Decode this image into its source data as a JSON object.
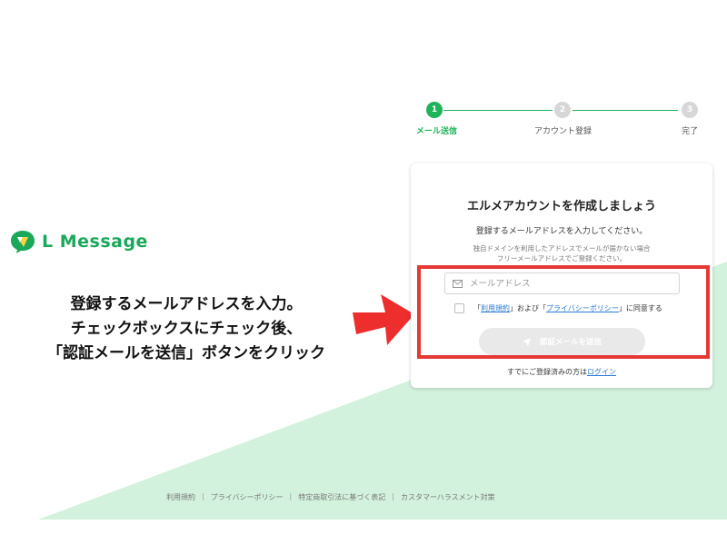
{
  "logo": {
    "text": "L Message"
  },
  "instructions": {
    "line1": "登録するメールアドレスを入力。",
    "line2": "チェックボックスにチェック後、",
    "line3": "「認証メールを送信」ボタンをクリック"
  },
  "stepper": {
    "steps": [
      {
        "number": "1",
        "label": "メール送信",
        "state": "active"
      },
      {
        "number": "2",
        "label": "アカウント登録",
        "state": "inactive"
      },
      {
        "number": "3",
        "label": "完了",
        "state": "inactive"
      }
    ]
  },
  "card": {
    "title": "エルメアカウントを作成しましょう",
    "subtitle": "登録するメールアドレスを入力してください。",
    "note_line1": "独自ドメインを利用したアドレスでメールが届かない場合",
    "note_line2": "フリーメールアドレスでご登録ください。",
    "email_placeholder": "メールアドレス",
    "email_value": "",
    "agree_open1": "「",
    "agree_terms": "利用規約",
    "agree_mid": "」および「",
    "agree_privacy": "プライバシーポリシー",
    "agree_close": "」に同意する",
    "checkbox_checked": false,
    "submit_label": "認証メールを送信",
    "login_prefix": "すでにご登録済みの方は",
    "login_link": "ログイン"
  },
  "footer": {
    "links": [
      "利用規約",
      "プライバシーポリシー",
      "特定商取引法に基づく表記",
      "カスタマーハラスメント対策"
    ],
    "separator": "|"
  },
  "colors": {
    "brand_green": "#1fb35a",
    "background_green": "#d3f2dd",
    "highlight_red": "#e53935",
    "arrow_red": "#ee2d2d",
    "link_blue": "#2a7ad5"
  },
  "icons": {
    "email_field": "envelope-icon",
    "submit_button": "paper-plane-icon",
    "logo": "speech-bubble-logo-icon",
    "callout": "right-arrow-icon"
  }
}
